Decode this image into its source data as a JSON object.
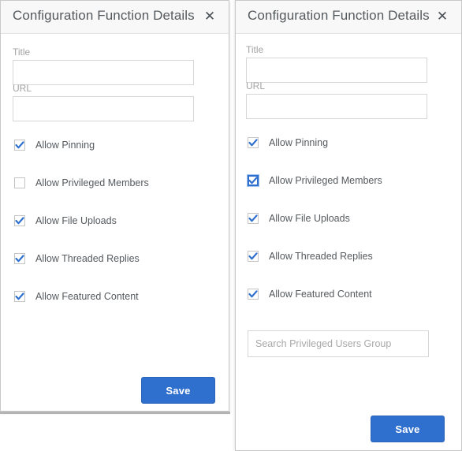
{
  "panels": [
    {
      "id": "left",
      "header": {
        "title": "Configuration Function Details",
        "close_icon": "close-icon",
        "close_glyph": "✕"
      },
      "fields": [
        {
          "label": "Title",
          "value": "",
          "placeholder": ""
        },
        {
          "label": "URL",
          "value": "",
          "placeholder": ""
        }
      ],
      "checkboxes": [
        {
          "label": "Allow Pinning",
          "checked": true,
          "focused": false
        },
        {
          "label": "Allow Privileged Members",
          "checked": false,
          "focused": false
        },
        {
          "label": "Allow File Uploads",
          "checked": true,
          "focused": false
        },
        {
          "label": "Allow Threaded Replies",
          "checked": true,
          "focused": false
        },
        {
          "label": "Allow Featured Content",
          "checked": true,
          "focused": false
        }
      ],
      "search": null,
      "save_label": "Save"
    },
    {
      "id": "right",
      "header": {
        "title": "Configuration Function Details",
        "close_icon": "close-icon",
        "close_glyph": "✕"
      },
      "fields": [
        {
          "label": "Title",
          "value": "",
          "placeholder": ""
        },
        {
          "label": "URL",
          "value": "",
          "placeholder": ""
        }
      ],
      "checkboxes": [
        {
          "label": "Allow Pinning",
          "checked": true,
          "focused": false
        },
        {
          "label": "Allow Privileged Members",
          "checked": true,
          "focused": true
        },
        {
          "label": "Allow File Uploads",
          "checked": true,
          "focused": false
        },
        {
          "label": "Allow Threaded Replies",
          "checked": true,
          "focused": false
        },
        {
          "label": "Allow Featured Content",
          "checked": true,
          "focused": false
        }
      ],
      "search": {
        "placeholder": "Search Privileged Users Group",
        "value": ""
      },
      "save_label": "Save"
    }
  ],
  "colors": {
    "accent_blue": "#2f6fce",
    "header_bg": "#f8f8f8",
    "label_gray": "#a3a3a3",
    "text_gray": "#555a5e",
    "border_gray": "#d6d6d6"
  }
}
